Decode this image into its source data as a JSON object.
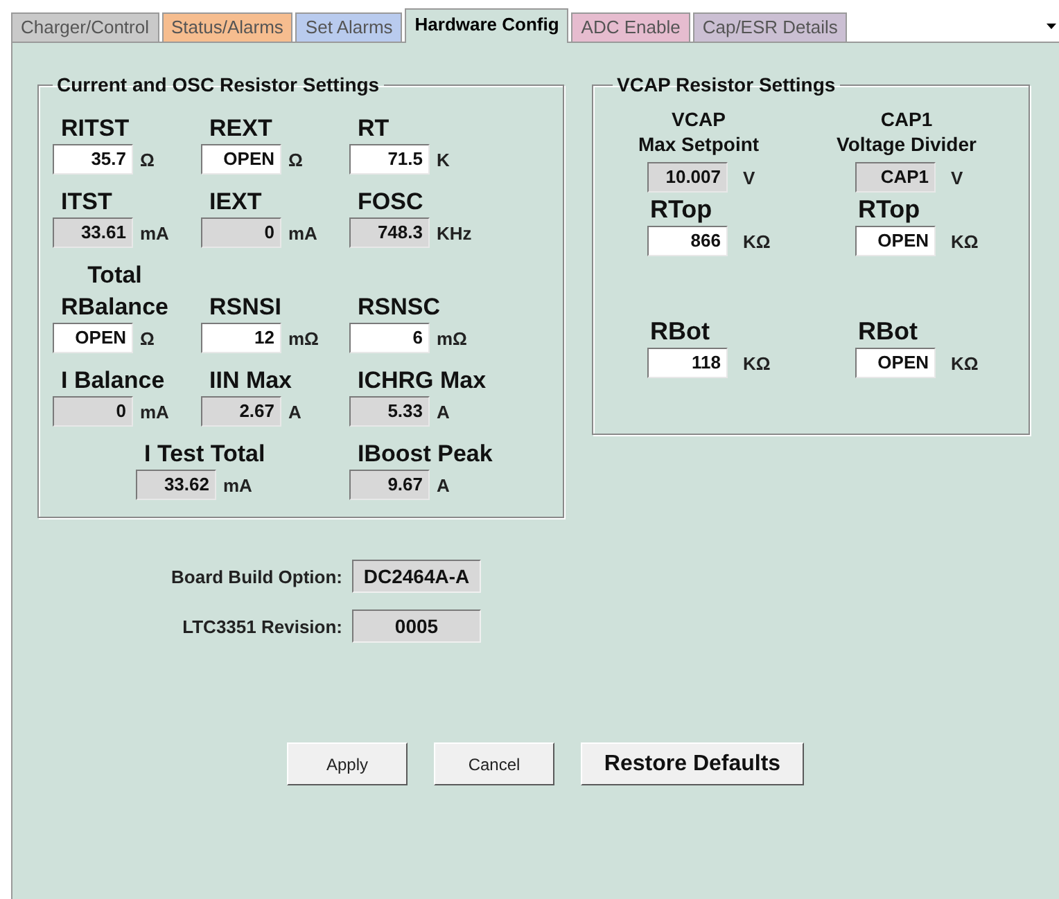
{
  "tabs": [
    {
      "label": "Charger/Control",
      "selected": false,
      "color": "#c9c9c9"
    },
    {
      "label": "Status/Alarms",
      "selected": false,
      "color": "#f6bd8f"
    },
    {
      "label": "Set Alarms",
      "selected": false,
      "color": "#b9cbee"
    },
    {
      "label": "Hardware Config",
      "selected": true,
      "color": "#cfe1da"
    },
    {
      "label": "ADC Enable",
      "selected": false,
      "color": "#e6bccf"
    },
    {
      "label": "Cap/ESR Details",
      "selected": false,
      "color": "#cbbfd3"
    }
  ],
  "current_osc_group": {
    "title": "Current and OSC Resistor Settings",
    "rows": [
      [
        {
          "label": "RITST",
          "kind": "input",
          "value": "35.7",
          "unit": "Ω"
        },
        {
          "label": "REXT",
          "kind": "input",
          "value": "OPEN",
          "unit": "Ω"
        },
        {
          "label": "RT",
          "kind": "input",
          "value": "71.5",
          "unit": "K"
        }
      ],
      [
        {
          "label": "ITST",
          "kind": "readout",
          "value": "33.61",
          "unit": "mA"
        },
        {
          "label": "IEXT",
          "kind": "readout",
          "value": "0",
          "unit": "mA"
        },
        {
          "label": "FOSC",
          "kind": "readout",
          "value": "748.3",
          "unit": "KHz"
        }
      ],
      [
        {
          "label": "Total\nRBalance",
          "kind": "input",
          "value": "OPEN",
          "unit": "Ω"
        },
        {
          "label": "RSNSI",
          "kind": "input",
          "value": "12",
          "unit": "mΩ"
        },
        {
          "label": "RSNSC",
          "kind": "input",
          "value": "6",
          "unit": "mΩ"
        }
      ],
      [
        {
          "label": "I Balance",
          "kind": "readout",
          "value": "0",
          "unit": "mA"
        },
        {
          "label": "IIN Max",
          "kind": "readout",
          "value": "2.67",
          "unit": "A"
        },
        {
          "label": "ICHRG Max",
          "kind": "readout",
          "value": "5.33",
          "unit": "A"
        }
      ]
    ],
    "totals": [
      {
        "label": "I Test Total",
        "kind": "readout",
        "value": "33.62",
        "unit": "mA"
      },
      {
        "label": "IBoost Peak",
        "kind": "readout",
        "value": "9.67",
        "unit": "A"
      }
    ]
  },
  "vcap_group": {
    "title": "VCAP Resistor Settings",
    "rows": [
      [
        {
          "label": "VCAP\nMax Setpoint",
          "kind": "readout",
          "value": "10.007",
          "unit": "V"
        },
        {
          "label": "CAP1\nVoltage Divider",
          "kind": "readout",
          "value": "CAP1",
          "unit": "V"
        }
      ],
      [
        {
          "label": "RTop",
          "kind": "input",
          "value": "866",
          "unit": "KΩ"
        },
        {
          "label": "RTop",
          "kind": "input",
          "value": "OPEN",
          "unit": "KΩ"
        }
      ],
      [
        {
          "label": "RBot",
          "kind": "input",
          "value": "118",
          "unit": "KΩ"
        },
        {
          "label": "RBot",
          "kind": "input",
          "value": "OPEN",
          "unit": "KΩ"
        }
      ]
    ]
  },
  "info": [
    {
      "label": "Board Build Option:",
      "value": "DC2464A-A"
    },
    {
      "label": "LTC3351 Revision:",
      "value": "0005"
    }
  ],
  "buttons": [
    {
      "label": "Apply",
      "kind": "normal"
    },
    {
      "label": "Cancel",
      "kind": "normal"
    },
    {
      "label": "Restore Defaults",
      "kind": "emphasis"
    }
  ]
}
